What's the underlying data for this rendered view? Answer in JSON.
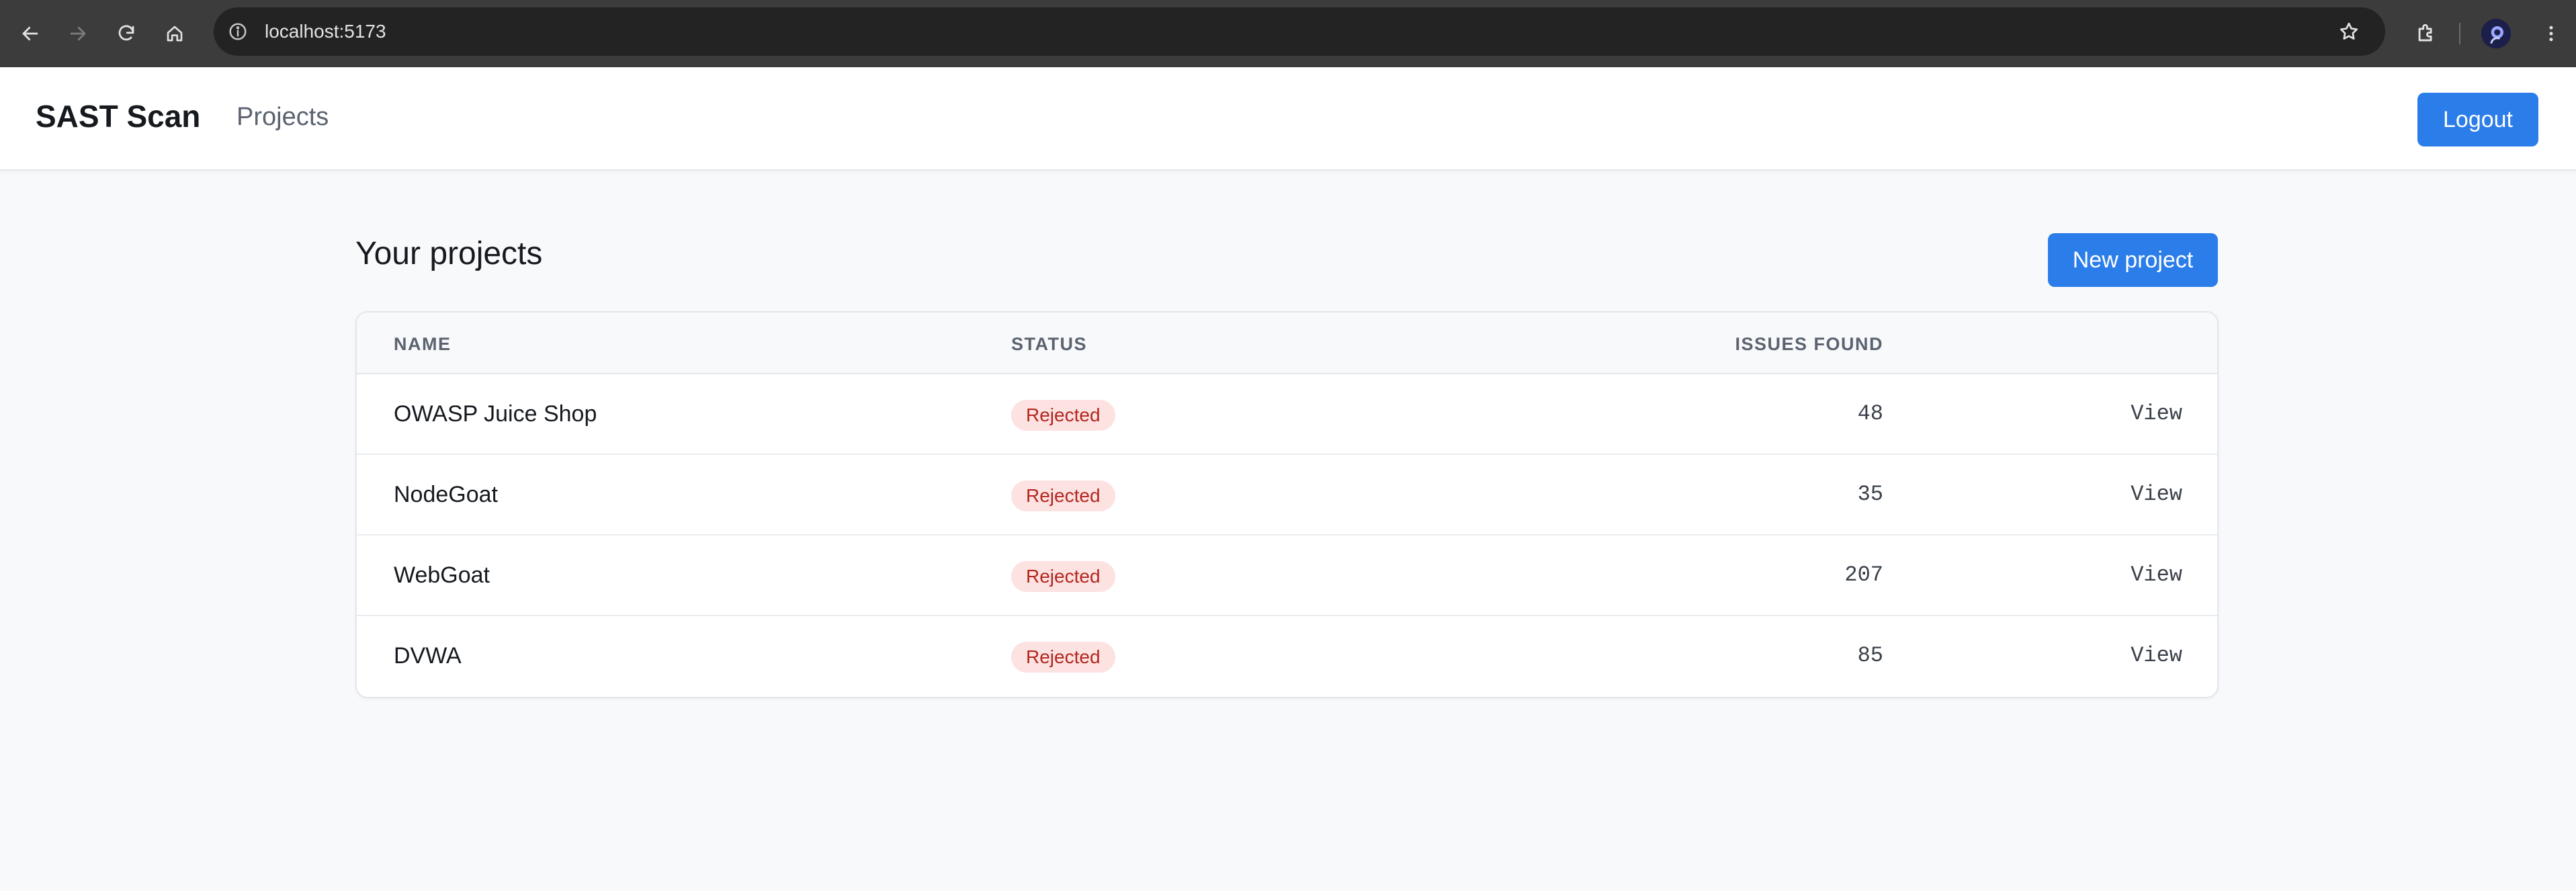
{
  "browser": {
    "url": "localhost:5173",
    "icons": [
      "back-icon",
      "forward-icon",
      "reload-icon",
      "home-icon",
      "info-icon",
      "star-icon",
      "extensions-icon",
      "profile-avatar",
      "more-menu-icon"
    ]
  },
  "header": {
    "brand": "SAST Scan",
    "nav_projects": "Projects",
    "logout_label": "Logout"
  },
  "main": {
    "title": "Your projects",
    "new_project_label": "New project",
    "table": {
      "columns": {
        "name": "NAME",
        "status": "STATUS",
        "issues": "ISSUES FOUND"
      },
      "rows": [
        {
          "name": "OWASP Juice Shop",
          "status": "Rejected",
          "issues": "48",
          "action": "View"
        },
        {
          "name": "NodeGoat",
          "status": "Rejected",
          "issues": "35",
          "action": "View"
        },
        {
          "name": "WebGoat",
          "status": "Rejected",
          "issues": "207",
          "action": "View"
        },
        {
          "name": "DVWA",
          "status": "Rejected",
          "issues": "85",
          "action": "View"
        }
      ]
    }
  },
  "colors": {
    "primary": "#2b7de9",
    "badge_bg": "#fde2e2",
    "badge_text": "#b3261e",
    "chrome_bg": "#3c3c3c",
    "page_bg": "#f8f9fb"
  }
}
